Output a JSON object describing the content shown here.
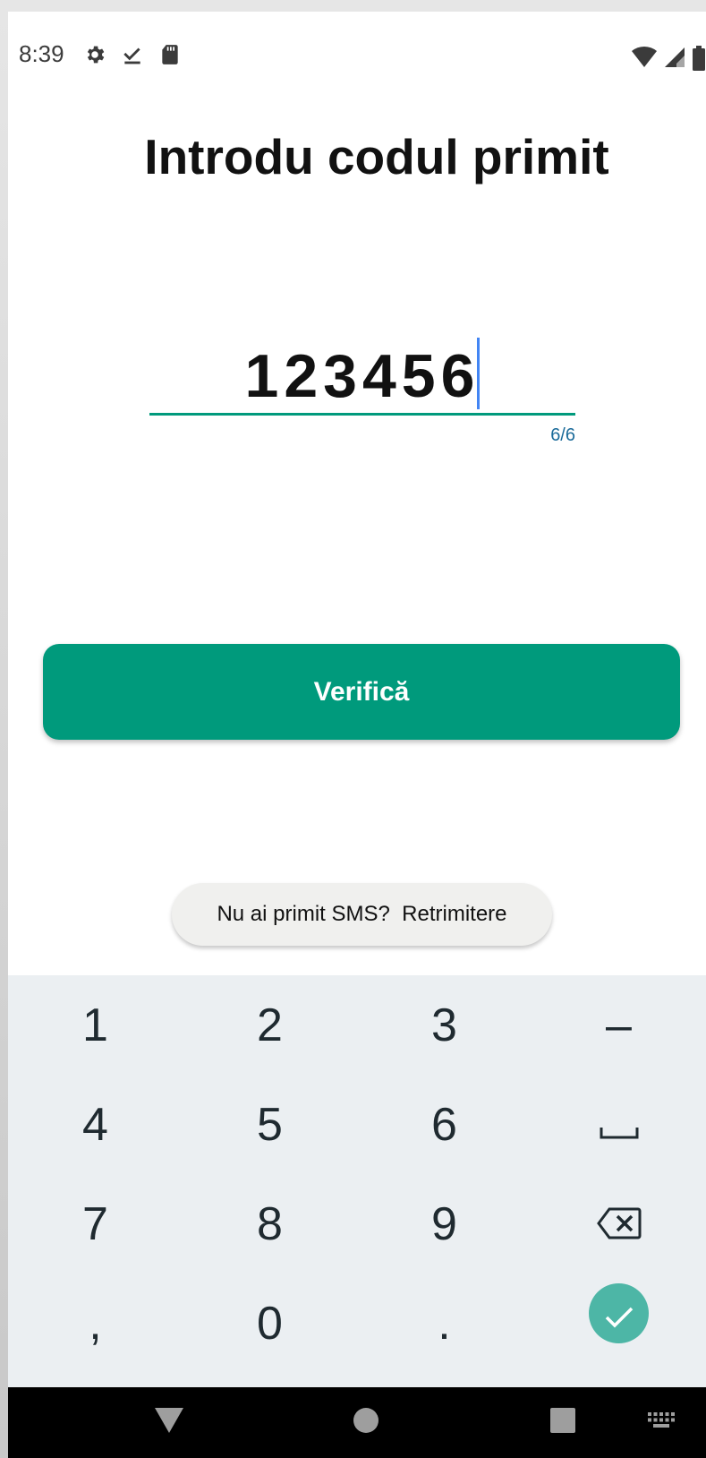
{
  "status_bar": {
    "time": "8:39",
    "left_icons": [
      "gear-icon",
      "download-done-icon",
      "sd-card-icon"
    ],
    "right_icons": [
      "wifi-icon",
      "signal-icon",
      "battery-icon"
    ]
  },
  "screen": {
    "title": "Introdu codul primit",
    "code_input": {
      "value": "123456",
      "counter": "6/6",
      "accent_color": "#009a7c"
    },
    "verify_button_label": "Verifică",
    "resend_text": "Nu ai primit SMS?  Retrimitere"
  },
  "keypad": {
    "rows": [
      [
        "1",
        "2",
        "3",
        "–"
      ],
      [
        "4",
        "5",
        "6",
        "space-icon"
      ],
      [
        "7",
        "8",
        "9",
        "backspace-icon"
      ],
      [
        ",",
        "0",
        ".",
        "check-icon"
      ]
    ],
    "keys": {
      "k1": "1",
      "k2": "2",
      "k3": "3",
      "dash": "–",
      "k4": "4",
      "k5": "5",
      "k6": "6",
      "k7": "7",
      "k8": "8",
      "k9": "9",
      "comma": ",",
      "k0": "0",
      "period": "."
    },
    "enter_color": "#4db6a6"
  },
  "nav_bar": {
    "items": [
      "back-icon",
      "home-icon",
      "recents-icon",
      "keyboard-switch-icon"
    ]
  }
}
